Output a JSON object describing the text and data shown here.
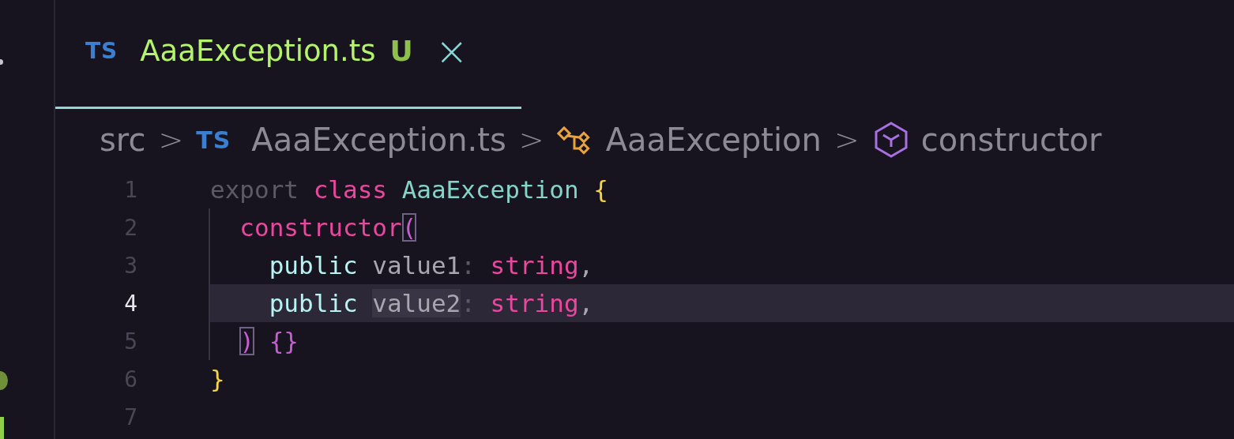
{
  "tabs": [
    {
      "icon_text": "TS",
      "label": "AaaException.ts",
      "status": "U",
      "close": "×",
      "selected": true
    }
  ],
  "breadcrumbs": [
    {
      "kind": "folder",
      "label": "src"
    },
    {
      "kind": "file",
      "icon_text": "TS",
      "label": "AaaException.ts"
    },
    {
      "kind": "class",
      "label": "AaaException"
    },
    {
      "kind": "method",
      "label": "constructor"
    }
  ],
  "separator": ">",
  "lines": [
    {
      "number": "1",
      "active": false,
      "tokens": [
        {
          "kind": "dim",
          "text": "export"
        },
        {
          "kind": "keyword",
          "text": " class"
        },
        {
          "kind": "classname",
          "text": " AaaException"
        },
        {
          "kind": "brace",
          "text": " {"
        }
      ],
      "children": [
        {
          "number": "2",
          "active": false,
          "tokens": [
            {
              "kind": "function",
              "text": "constructor"
            },
            {
              "kind": "bracket-match",
              "text": "("
            }
          ],
          "children": [
            {
              "number": "3",
              "active": false,
              "tokens": [
                {
                  "kind": "modifier",
                  "text": "public"
                },
                {
                  "kind": "param",
                  "text": " value1"
                },
                {
                  "kind": "dim",
                  "text": ":"
                },
                {
                  "kind": "type",
                  "text": " string"
                },
                {
                  "kind": "param",
                  "text": ","
                }
              ]
            },
            {
              "number": "4",
              "active": true,
              "tokens": [
                {
                  "kind": "modifier",
                  "text": "public "
                },
                {
                  "kind": "param-match",
                  "text": "value2"
                },
                {
                  "kind": "dim",
                  "text": ":"
                },
                {
                  "kind": "type",
                  "text": " string"
                },
                {
                  "kind": "param",
                  "text": ","
                }
              ]
            }
          ]
        },
        {
          "number": "5",
          "active": false,
          "tokens": [
            {
              "kind": "bracket-match",
              "text": ")"
            },
            {
              "kind": "braces",
              "text": " {}"
            }
          ]
        }
      ]
    },
    {
      "number": "6",
      "active": false,
      "tokens": [
        {
          "kind": "brace",
          "text": "}"
        }
      ]
    },
    {
      "number": "7",
      "active": false
    }
  ]
}
